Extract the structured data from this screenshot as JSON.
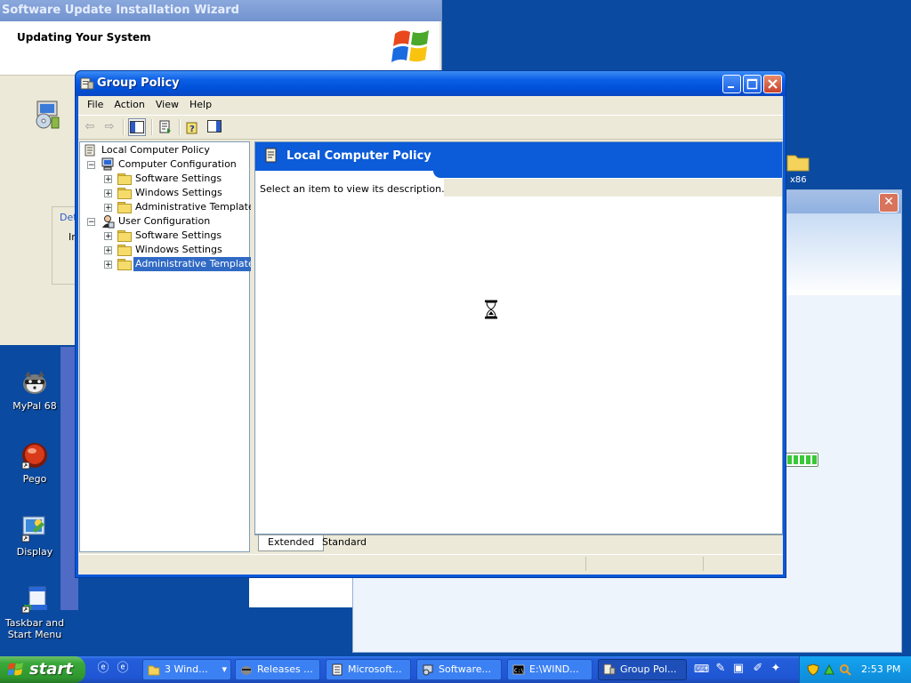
{
  "wizard": {
    "title": "Software Update Installation Wizard",
    "header_title": "Updating Your System",
    "link_fragment": "Det",
    "text_fragment": "In"
  },
  "desktop": {
    "icons": [
      {
        "label": "MyPal 68",
        "icon": "raccoon-icon"
      },
      {
        "label": "Pego",
        "icon": "red-orb-icon"
      },
      {
        "label": "Display",
        "icon": "display-icon"
      },
      {
        "label": "Taskbar and Start Menu",
        "icon": "taskbar-icon"
      }
    ],
    "folder_fragment": "x86"
  },
  "gp": {
    "title": "Group Policy",
    "menu": [
      "File",
      "Action",
      "View",
      "Help"
    ],
    "tree": {
      "root": "Local Computer Policy",
      "computer_config": "Computer Configuration",
      "cc_software": "Software Settings",
      "cc_windows": "Windows Settings",
      "cc_admin": "Administrative Templates",
      "user_config": "User Configuration",
      "uc_software": "Software Settings",
      "uc_windows": "Windows Settings",
      "uc_admin": "Administrative Templates"
    },
    "pane_title": "Local Computer Policy",
    "description": "Select an item to view its description.",
    "tabs": [
      "Extended",
      "Standard"
    ]
  },
  "taskbar": {
    "start": "start",
    "tasks": [
      "3 Wind...",
      "Releases ...",
      "Microsoft...",
      "Software...",
      "E:\\WIND...",
      "Group Pol..."
    ],
    "clock": "2:53 PM"
  },
  "colors": {
    "xp_blue": "#0a58d8",
    "selection": "#316ac5",
    "start_green": "#3aa83a"
  }
}
